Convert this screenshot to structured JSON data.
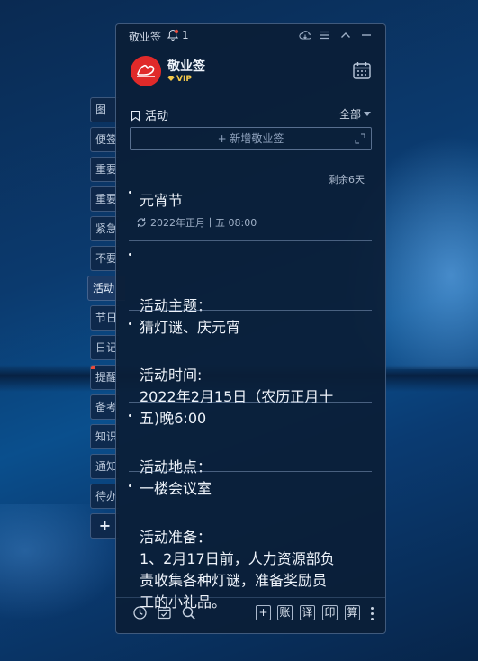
{
  "app": {
    "name": "敬业签",
    "notification_count": "1"
  },
  "user": {
    "name": "敬业签",
    "badge": "VIP"
  },
  "tabs": [
    {
      "label": "图"
    },
    {
      "label": "便签"
    },
    {
      "label": "重要"
    },
    {
      "label": "重要"
    },
    {
      "label": "紧急"
    },
    {
      "label": "不要"
    },
    {
      "label": "活动",
      "active": true
    },
    {
      "label": "节日"
    },
    {
      "label": "日记"
    },
    {
      "label": "提醒",
      "dot": true
    },
    {
      "label": "备考"
    },
    {
      "label": "知识"
    },
    {
      "label": "通知"
    },
    {
      "label": "待办"
    },
    {
      "label": "+"
    }
  ],
  "section": {
    "title": "活动",
    "filter": "全部"
  },
  "new_note_placeholder": "+ 新增敬业签",
  "remaining": "剩余6天",
  "notes": [
    {
      "text": "元宵节"
    },
    {
      "text": "活动主题：\n猜灯谜、庆元宵"
    },
    {
      "text": "活动时间:\n2022年2月15日（农历正月十\n五)晚6:00"
    },
    {
      "text": "活动地点：\n一楼会议室"
    },
    {
      "text": "活动准备：\n1、2月17日前，人力资源部负\n责收集各种灯谜，准备奖励员\n工的小礼品。"
    }
  ],
  "reminder": "2022年正月十五 08:00",
  "footer": {
    "buttons": [
      "+",
      "账",
      "译",
      "印",
      "算"
    ]
  },
  "colors": {
    "brand_red": "#e02a2a",
    "vip_gold": "#f3c84b"
  }
}
